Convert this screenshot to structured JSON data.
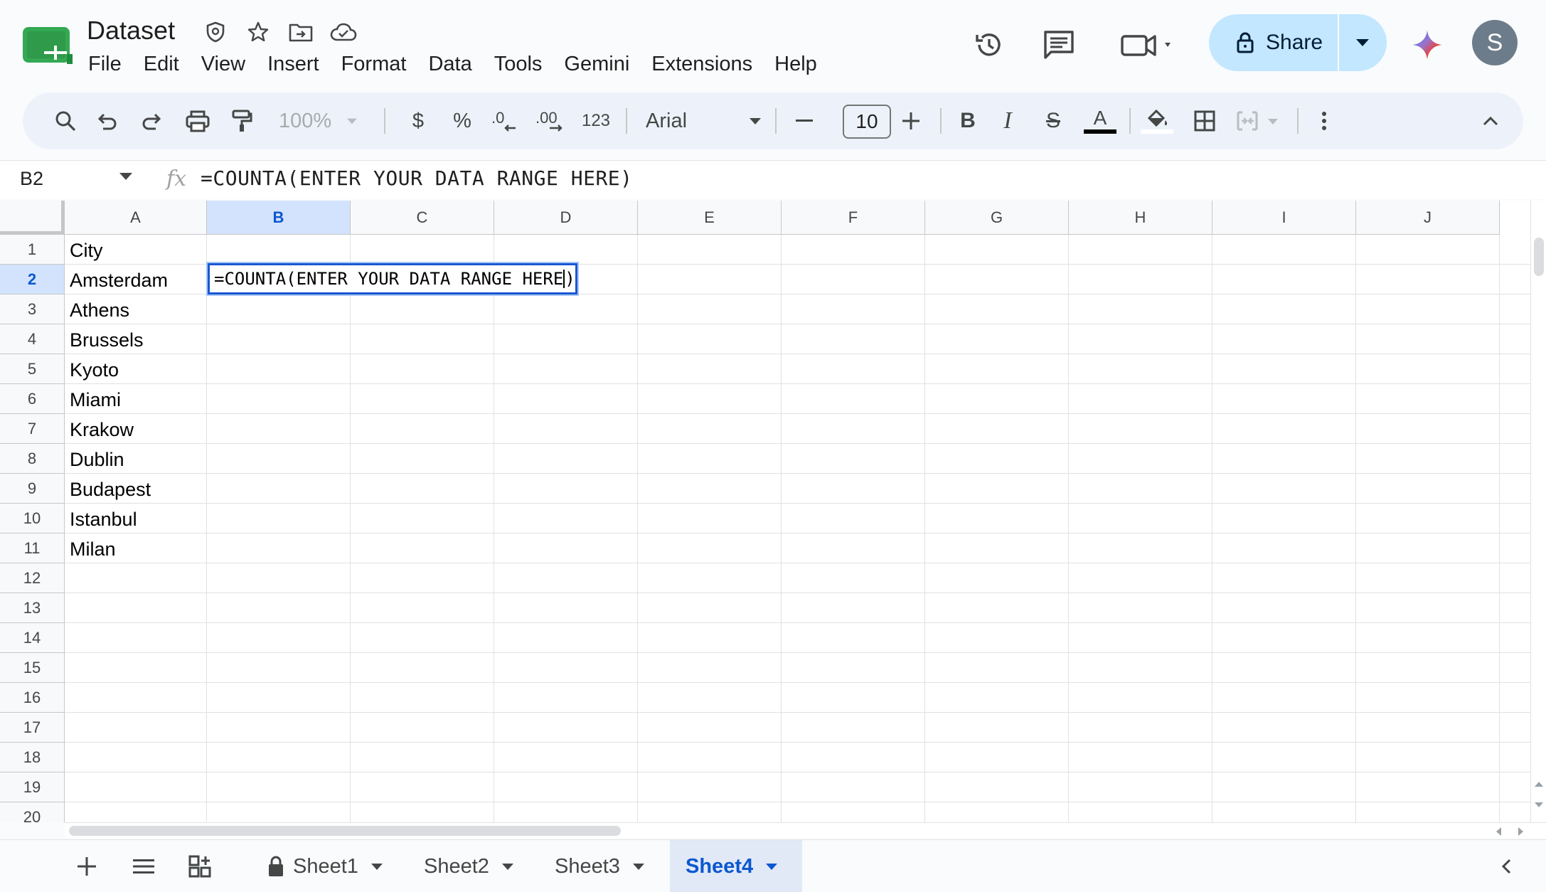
{
  "window": {
    "doc_title": "Dataset"
  },
  "menu": [
    "File",
    "Edit",
    "View",
    "Insert",
    "Format",
    "Data",
    "Tools",
    "Gemini",
    "Extensions",
    "Help"
  ],
  "share": {
    "label": "Share"
  },
  "account": {
    "initial": "S"
  },
  "toolbar": {
    "zoom": "100%",
    "currency": "$",
    "percent": "%",
    "number_format": "123",
    "font": "Arial",
    "font_size": "10"
  },
  "formula_bar": {
    "name_box": "B2",
    "fx": "fx",
    "formula": "=COUNTA(ENTER YOUR DATA RANGE HERE)"
  },
  "sheet": {
    "columns": [
      "A",
      "B",
      "C",
      "D",
      "E",
      "F",
      "G",
      "H",
      "I",
      "J"
    ],
    "selected_column": "B",
    "rows": [
      "1",
      "2",
      "3",
      "4",
      "5",
      "6",
      "7",
      "8",
      "9",
      "10",
      "11",
      "12",
      "13",
      "14",
      "15",
      "16",
      "17",
      "18",
      "19",
      "20"
    ],
    "selected_row": "2",
    "column_a": [
      "City",
      "Amsterdam",
      "Athens",
      "Brussels",
      "Kyoto",
      "Miami",
      "Krakow",
      "Dublin",
      "Budapest",
      "Istanbul",
      "Milan"
    ],
    "editing_cell": {
      "address": "B2",
      "text": "=COUNTA(ENTER YOUR DATA RANGE HERE",
      "text_after_caret": ")"
    }
  },
  "tabs": [
    {
      "label": "Sheet1",
      "locked": true,
      "active": false
    },
    {
      "label": "Sheet2",
      "locked": false,
      "active": false
    },
    {
      "label": "Sheet3",
      "locked": false,
      "active": false
    },
    {
      "label": "Sheet4",
      "locked": false,
      "active": true
    }
  ],
  "colors": {
    "accent": "#0b57d0",
    "share_bg": "#c2e7ff",
    "selection_header": "#d3e3fd",
    "app_green": "#34a853"
  }
}
